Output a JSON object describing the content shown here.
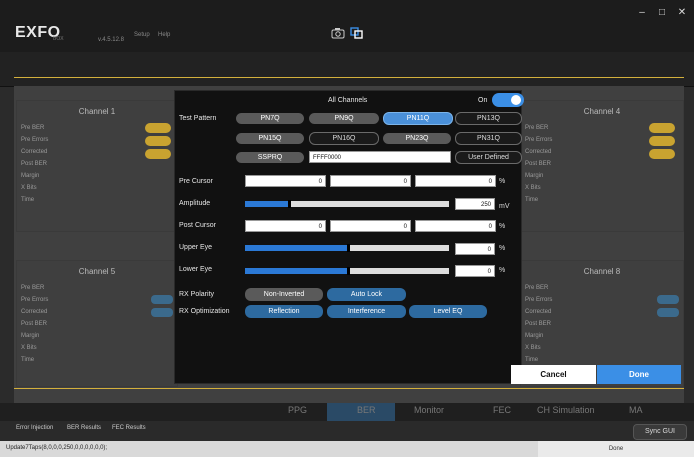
{
  "app": {
    "logo": "EXFO",
    "logo_sub": "BOX",
    "version": "v.4.5.12.8",
    "menu": [
      "Setup",
      "Help"
    ]
  },
  "window": {
    "minimize": "–",
    "maximize": "□",
    "close": "✕"
  },
  "background": {
    "channels": [
      {
        "title": "Channel 1",
        "rows": [
          "Pre BER",
          "Pre Errors",
          "Corrected",
          "Post BER",
          "Margin",
          "X Bits",
          "Time"
        ]
      },
      {
        "title": "Channel 4",
        "rows": [
          "Pre BER",
          "Pre Errors",
          "Corrected",
          "Post BER",
          "Margin",
          "X Bits",
          "Time"
        ]
      },
      {
        "title": "Channel 5",
        "rows": [
          "Pre BER",
          "Pre Errors",
          "Corrected",
          "Post BER",
          "Margin",
          "X Bits",
          "Time"
        ]
      },
      {
        "title": "Channel 8",
        "rows": [
          "Pre BER",
          "Pre Errors",
          "Corrected",
          "Post BER",
          "Margin",
          "X Bits",
          "Time"
        ]
      }
    ]
  },
  "modal": {
    "all_channels_label": "All Channels",
    "on_label": "On",
    "test_pattern_label": "Test Pattern",
    "patterns_row1": [
      "PN7Q",
      "PN9Q",
      "PN11Q",
      "PN13Q"
    ],
    "patterns_row2": [
      "PN15Q",
      "PN16Q",
      "PN23Q",
      "PN31Q"
    ],
    "ssprq_label": "SSPRQ",
    "user_pattern_value": "FFFF0000",
    "user_defined_label": "User Defined",
    "pre_cursor_label": "Pre Cursor",
    "pre_cursor_values": [
      "0",
      "0",
      "0"
    ],
    "amplitude_label": "Amplitude",
    "amplitude_value": "250",
    "amplitude_unit": "mV",
    "amplitude_level": 0.21,
    "post_cursor_label": "Post Cursor",
    "post_cursor_values": [
      "0",
      "0",
      "0"
    ],
    "upper_eye_label": "Upper Eye",
    "upper_eye_value": "0",
    "upper_eye_level": 0.5,
    "lower_eye_label": "Lower Eye",
    "lower_eye_value": "0",
    "lower_eye_level": 0.5,
    "percent_unit": "%",
    "rx_polarity_label": "RX Polarity",
    "rx_polarity_options": [
      "Non-Inverted",
      "Auto Lock"
    ],
    "rx_optimization_label": "RX Optimization",
    "rx_optimization_options": [
      "Reflection",
      "Interference",
      "Level EQ"
    ]
  },
  "actions": {
    "cancel": "Cancel",
    "done": "Done"
  },
  "tabs": [
    "PPG",
    "BER",
    "Monitor",
    "FEC",
    "CH Simulation",
    "MA"
  ],
  "results_tabs": [
    "Error Injection",
    "BER Results",
    "FEC Results"
  ],
  "sync_button": "Sync GUI",
  "status": {
    "text": "Update7Taps(8,0,0,0,250,0,0,0,0,0,0);",
    "state": "Done"
  },
  "colors": {
    "accent": "#3b8fe6",
    "highlight": "#d4b03c"
  }
}
